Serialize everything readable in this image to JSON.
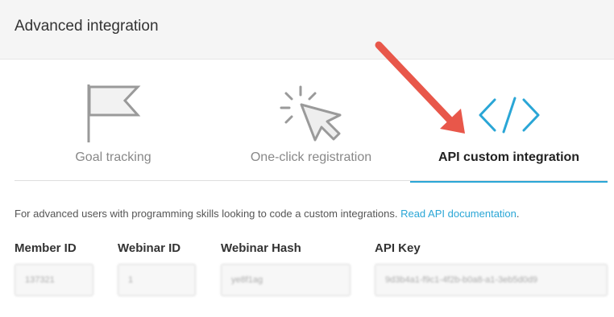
{
  "header": {
    "title": "Advanced integration"
  },
  "tabs": [
    {
      "label": "Goal tracking",
      "icon": "flag-icon",
      "active": false
    },
    {
      "label": "One-click registration",
      "icon": "cursor-click-icon",
      "active": false
    },
    {
      "label": "API custom integration",
      "icon": "code-icon",
      "active": true
    }
  ],
  "description": {
    "text": "For advanced users with programming skills looking to code a custom integrations.",
    "link": "Read API documentation",
    "after": "."
  },
  "fields": [
    {
      "label": "Member ID",
      "value": "137321"
    },
    {
      "label": "Webinar ID",
      "value": "1"
    },
    {
      "label": "Webinar Hash",
      "value": "ye8f1ag"
    },
    {
      "label": "API Key",
      "value": "9d3b4a1-f9c1-4f2b-b0a8-a1-3eb5d0d9"
    }
  ],
  "colors": {
    "accent": "#2aa6d6",
    "annotation_arrow": "#e8574a"
  }
}
